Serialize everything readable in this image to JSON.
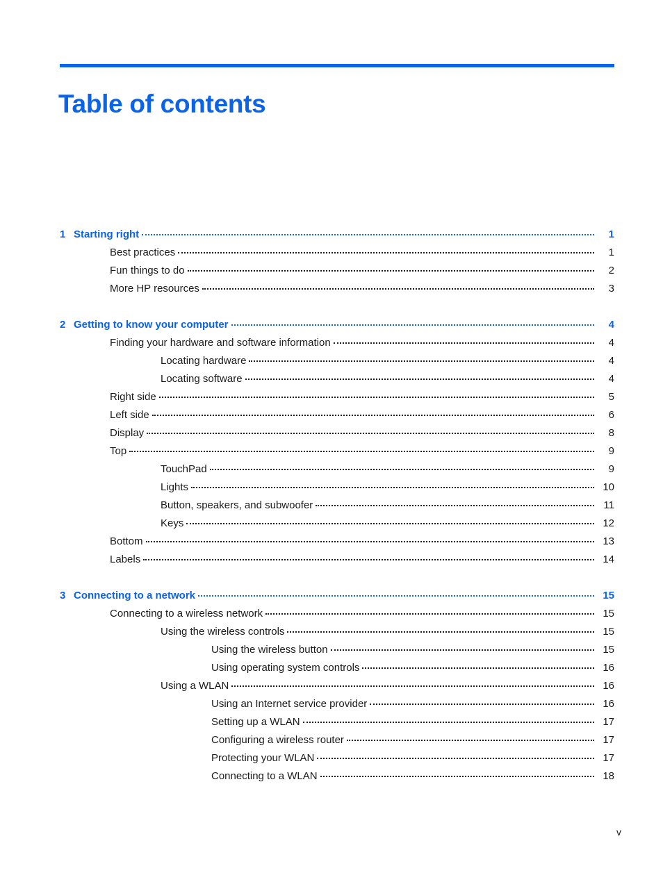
{
  "document": {
    "title": "Table of contents",
    "footer_page_label": "v",
    "accent_color": "#0b63e5",
    "text_color": "#1a1a1a"
  },
  "toc": {
    "groups": [
      {
        "chapter": {
          "number": "1",
          "label": "Starting right",
          "page": "1"
        },
        "entries": [
          {
            "level": 1,
            "label": "Best practices",
            "page": "1"
          },
          {
            "level": 1,
            "label": "Fun things to do",
            "page": "2"
          },
          {
            "level": 1,
            "label": "More HP resources",
            "page": "3"
          }
        ]
      },
      {
        "chapter": {
          "number": "2",
          "label": "Getting to know your computer",
          "page": "4"
        },
        "entries": [
          {
            "level": 1,
            "label": "Finding your hardware and software information",
            "page": "4"
          },
          {
            "level": 2,
            "label": "Locating hardware",
            "page": "4"
          },
          {
            "level": 2,
            "label": "Locating software",
            "page": "4"
          },
          {
            "level": 1,
            "label": "Right side",
            "page": "5"
          },
          {
            "level": 1,
            "label": "Left side",
            "page": "6"
          },
          {
            "level": 1,
            "label": "Display",
            "page": "8"
          },
          {
            "level": 1,
            "label": "Top",
            "page": "9"
          },
          {
            "level": 2,
            "label": "TouchPad",
            "page": "9"
          },
          {
            "level": 2,
            "label": "Lights",
            "page": "10"
          },
          {
            "level": 2,
            "label": "Button, speakers, and subwoofer",
            "page": "11"
          },
          {
            "level": 2,
            "label": "Keys",
            "page": "12"
          },
          {
            "level": 1,
            "label": "Bottom",
            "page": "13"
          },
          {
            "level": 1,
            "label": "Labels",
            "page": "14"
          }
        ]
      },
      {
        "chapter": {
          "number": "3",
          "label": "Connecting to a network",
          "page": "15"
        },
        "entries": [
          {
            "level": 1,
            "label": "Connecting to a wireless network",
            "page": "15"
          },
          {
            "level": 2,
            "label": "Using the wireless controls",
            "page": "15"
          },
          {
            "level": 3,
            "label": "Using the wireless button",
            "page": "15"
          },
          {
            "level": 3,
            "label": "Using operating system controls",
            "page": "16"
          },
          {
            "level": 2,
            "label": "Using a WLAN",
            "page": "16"
          },
          {
            "level": 3,
            "label": "Using an Internet service provider",
            "page": "16"
          },
          {
            "level": 3,
            "label": "Setting up a WLAN",
            "page": "17"
          },
          {
            "level": 3,
            "label": "Configuring a wireless router",
            "page": "17"
          },
          {
            "level": 3,
            "label": "Protecting your WLAN",
            "page": "17"
          },
          {
            "level": 3,
            "label": "Connecting to a WLAN",
            "page": "18"
          }
        ]
      }
    ]
  }
}
